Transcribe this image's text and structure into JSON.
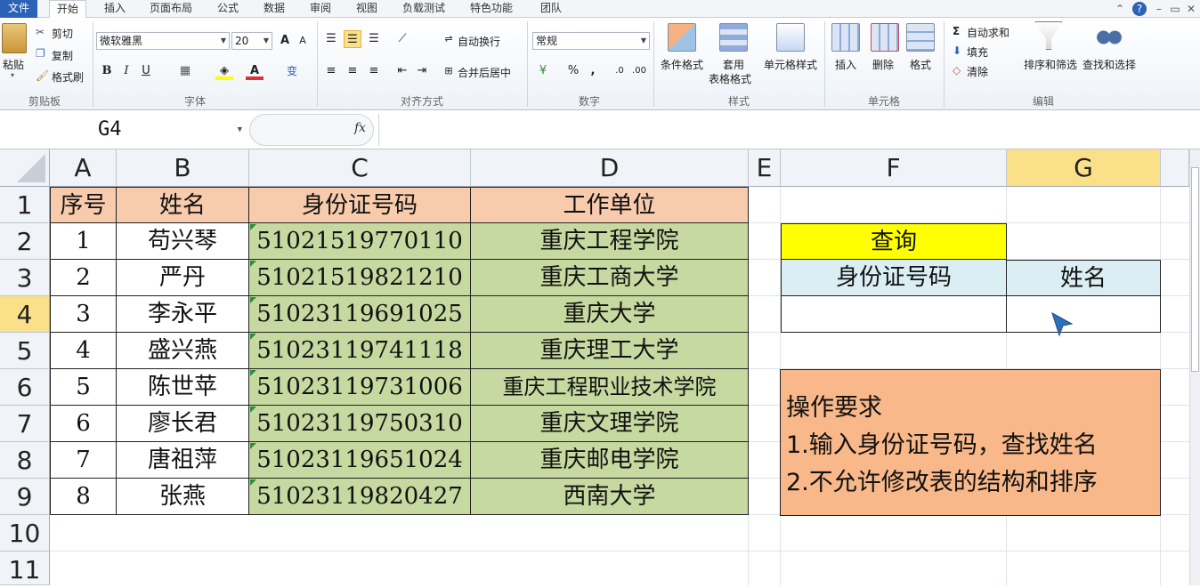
{
  "tabs": [
    "文件",
    "开始",
    "插入",
    "页面布局",
    "公式",
    "数据",
    "审阅",
    "视图",
    "负载测试",
    "特色功能",
    "团队"
  ],
  "ribbon": {
    "clipboard": {
      "paste": "粘贴",
      "cut": "剪切",
      "copy": "复制",
      "format_painter": "格式刷",
      "label": "剪贴板"
    },
    "font": {
      "name": "微软雅黑",
      "size": "20",
      "label": "字体",
      "bold": "B",
      "italic": "I",
      "underline": "U",
      "grow": "A",
      "shrink": "A",
      "wen": "变"
    },
    "align": {
      "wrap": "自动换行",
      "merge": "合并后居中",
      "label": "对齐方式"
    },
    "number": {
      "format": "常规",
      "percent": "%",
      "comma": ",",
      "inc": ".0",
      "dec": ".00",
      "label": "数字"
    },
    "styles": {
      "cond": "条件格式",
      "table1": "套用",
      "table2": "表格格式",
      "cell_style": "单元格样式",
      "label": "样式"
    },
    "cells": {
      "insert": "插入",
      "delete": "删除",
      "format": "格式",
      "label": "单元格"
    },
    "editing": {
      "autosum": "自动求和",
      "fill": "填充",
      "clear": "清除",
      "sort": "排序和筛选",
      "find": "查找和选择",
      "label": "编辑",
      "sigma": "Σ"
    }
  },
  "formula_bar": {
    "name_box": "G4",
    "fx": "fx",
    "value": ""
  },
  "columns": [
    "A",
    "B",
    "C",
    "D",
    "E",
    "F",
    "G"
  ],
  "rows": [
    "1",
    "2",
    "3",
    "4",
    "5",
    "6",
    "7",
    "8",
    "9",
    "10",
    "11"
  ],
  "table": {
    "headers": [
      "序号",
      "姓名",
      "身份证号码",
      "工作单位"
    ],
    "rows": [
      [
        "1",
        "苟兴琴",
        "51021519770110",
        "重庆工程学院"
      ],
      [
        "2",
        "严丹",
        "51021519821210",
        "重庆工商大学"
      ],
      [
        "3",
        "李永平",
        "51023119691025",
        "重庆大学"
      ],
      [
        "4",
        "盛兴燕",
        "51023119741118",
        "重庆理工大学"
      ],
      [
        "5",
        "陈世苹",
        "51023119731006",
        "重庆工程职业技术学院"
      ],
      [
        "6",
        "廖长君",
        "51023119750310",
        "重庆文理学院"
      ],
      [
        "7",
        "唐祖萍",
        "51023119651024",
        "重庆邮电学院"
      ],
      [
        "8",
        "张燕",
        "51023119820427",
        "西南大学"
      ]
    ]
  },
  "lookup": {
    "title": "查询",
    "id_header": "身份证号码",
    "name_header": "姓名",
    "id_value": "",
    "name_value": ""
  },
  "note": {
    "line1": "操作要求",
    "line2": "1.输入身份证号码，查找姓名",
    "line3": "2.不允许修改表的结构和排序"
  },
  "colors": {
    "header_fill": "#f8cbad",
    "data_fill": "#c6d9a0",
    "query_fill": "#ffff00",
    "lookup_header_fill": "#daeef3",
    "note_fill": "#f8b889"
  }
}
